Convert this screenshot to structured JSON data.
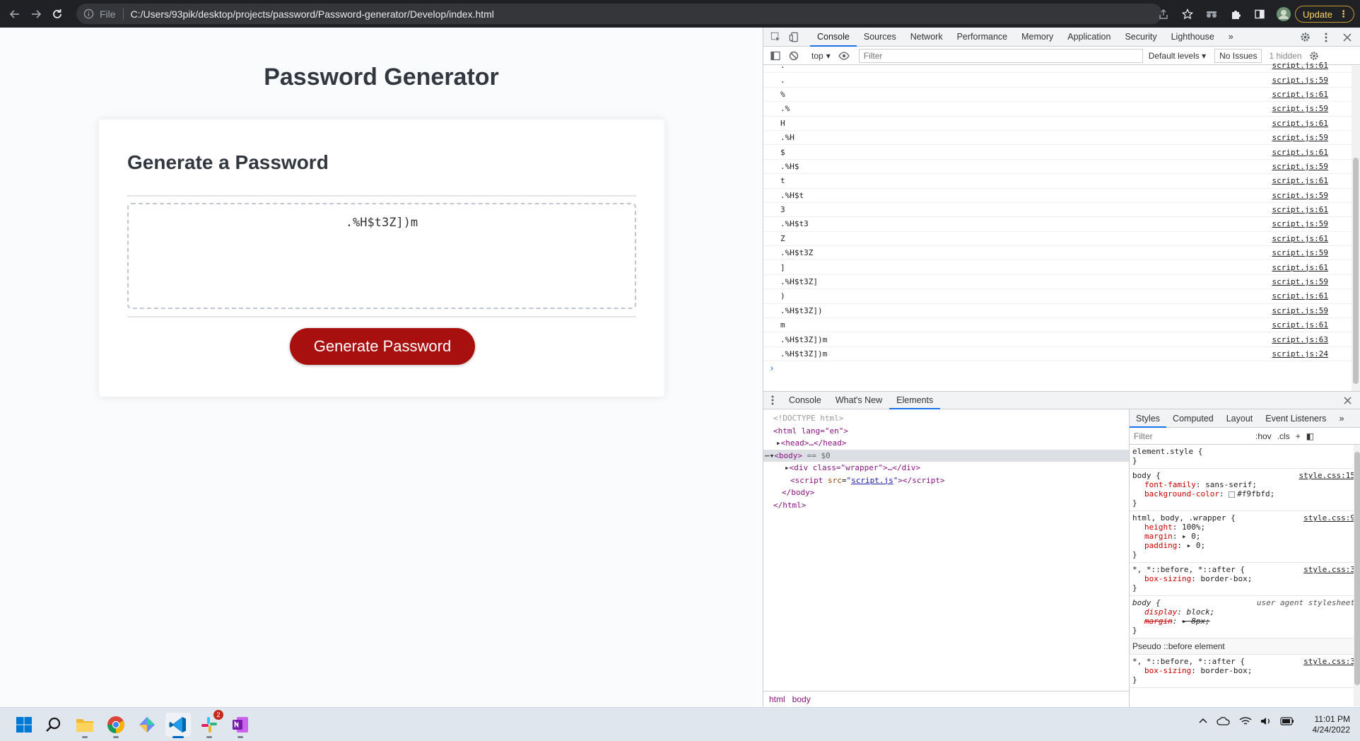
{
  "browser": {
    "scheme_label": "File",
    "address": "C:/Users/93pik/desktop/projects/password/Password-generator/Develop/index.html",
    "update_label": "Update"
  },
  "page": {
    "title": "Password Generator",
    "card_header": "Generate a Password",
    "password_value": ".%H$t3Z])m",
    "button_label": "Generate Password"
  },
  "devtools": {
    "tabs": [
      "Console",
      "Sources",
      "Network",
      "Performance",
      "Memory",
      "Application",
      "Security",
      "Lighthouse"
    ],
    "more_tabs": "»",
    "context": "top",
    "filter_placeholder": "Filter",
    "levels": "Default levels",
    "issues": "No Issues",
    "hidden": "1 hidden",
    "prompt": "›",
    "console_log": [
      {
        "text": ".",
        "src": "script.js:61"
      },
      {
        "text": ".",
        "src": "script.js:59"
      },
      {
        "text": "%",
        "src": "script.js:61"
      },
      {
        "text": ".%",
        "src": "script.js:59"
      },
      {
        "text": "H",
        "src": "script.js:61"
      },
      {
        "text": ".%H",
        "src": "script.js:59"
      },
      {
        "text": "$",
        "src": "script.js:61"
      },
      {
        "text": ".%H$",
        "src": "script.js:59"
      },
      {
        "text": "t",
        "src": "script.js:61"
      },
      {
        "text": ".%H$t",
        "src": "script.js:59"
      },
      {
        "text": "3",
        "src": "script.js:61"
      },
      {
        "text": ".%H$t3",
        "src": "script.js:59"
      },
      {
        "text": "Z",
        "src": "script.js:61"
      },
      {
        "text": ".%H$t3Z",
        "src": "script.js:59"
      },
      {
        "text": "]",
        "src": "script.js:61"
      },
      {
        "text": ".%H$t3Z]",
        "src": "script.js:59"
      },
      {
        "text": ")",
        "src": "script.js:61"
      },
      {
        "text": ".%H$t3Z])",
        "src": "script.js:59"
      },
      {
        "text": "m",
        "src": "script.js:61"
      },
      {
        "text": ".%H$t3Z])m",
        "src": "script.js:63"
      },
      {
        "text": ".%H$t3Z])m",
        "src": "script.js:24"
      }
    ],
    "drawer_tabs": [
      "Console",
      "What's New",
      "Elements"
    ],
    "elements": {
      "doctype": "<!DOCTYPE html>",
      "html_open": "<html lang=\"en\">",
      "head": "<head>…</head>",
      "body_open": "<body>",
      "body_eq": "== $0",
      "div_open": "<div class=\"wrapper\">…</div>",
      "script_src": "script.js",
      "body_close": "</body>",
      "html_close": "</html>"
    },
    "breadcrumbs": [
      "html",
      "body"
    ],
    "styles_tabs": [
      "Styles",
      "Computed",
      "Layout",
      "Event Listeners"
    ],
    "styles_filter": "Filter",
    "hov": ":hov",
    "cls": ".cls",
    "pseudo_header": "Pseudo ::before element",
    "rules": {
      "element_style": "element.style {",
      "body_selector": "body {",
      "body_loc": "style.css:15",
      "body_font_name": "font-family",
      "body_font_value": "sans-serif;",
      "body_bg_name": "background-color",
      "body_bg_value": "#f9fbfd;",
      "hbw_selector": "html, body, .wrapper {",
      "hbw_loc": "style.css:9",
      "height_name": "height",
      "height_value": "100%;",
      "margin_name": "margin",
      "margin_value": "▸ 0;",
      "padding_name": "padding",
      "padding_value": "▸ 0;",
      "star_selector": "*, *::before, *::after {",
      "star_loc": "style.css:3",
      "box_name": "box-sizing",
      "box_value": "border-box;",
      "ua_selector": "body {",
      "ua_label": "user agent stylesheet",
      "display_name": "display",
      "display_value": "block;",
      "ua_margin_name": "margin",
      "ua_margin_value": "▸ 8px;",
      "pseudo_selector": "*, *::before, *::after {",
      "pseudo_loc": "style.css:3",
      "pseudo_box_name": "box-sizing",
      "pseudo_box_value": "border-box;",
      "close": "}"
    }
  },
  "taskbar": {
    "apps": [
      "windows-start",
      "search",
      "file-explorer",
      "chrome",
      "gitkraken",
      "vscode",
      "slack",
      "onenote"
    ],
    "slack_badge": "2",
    "time": "11:01 PM",
    "date": "4/24/2022"
  },
  "colors": {
    "button": "#a80f0f",
    "page_bg": "#f9fbfd",
    "accent": "#1a73e8"
  }
}
